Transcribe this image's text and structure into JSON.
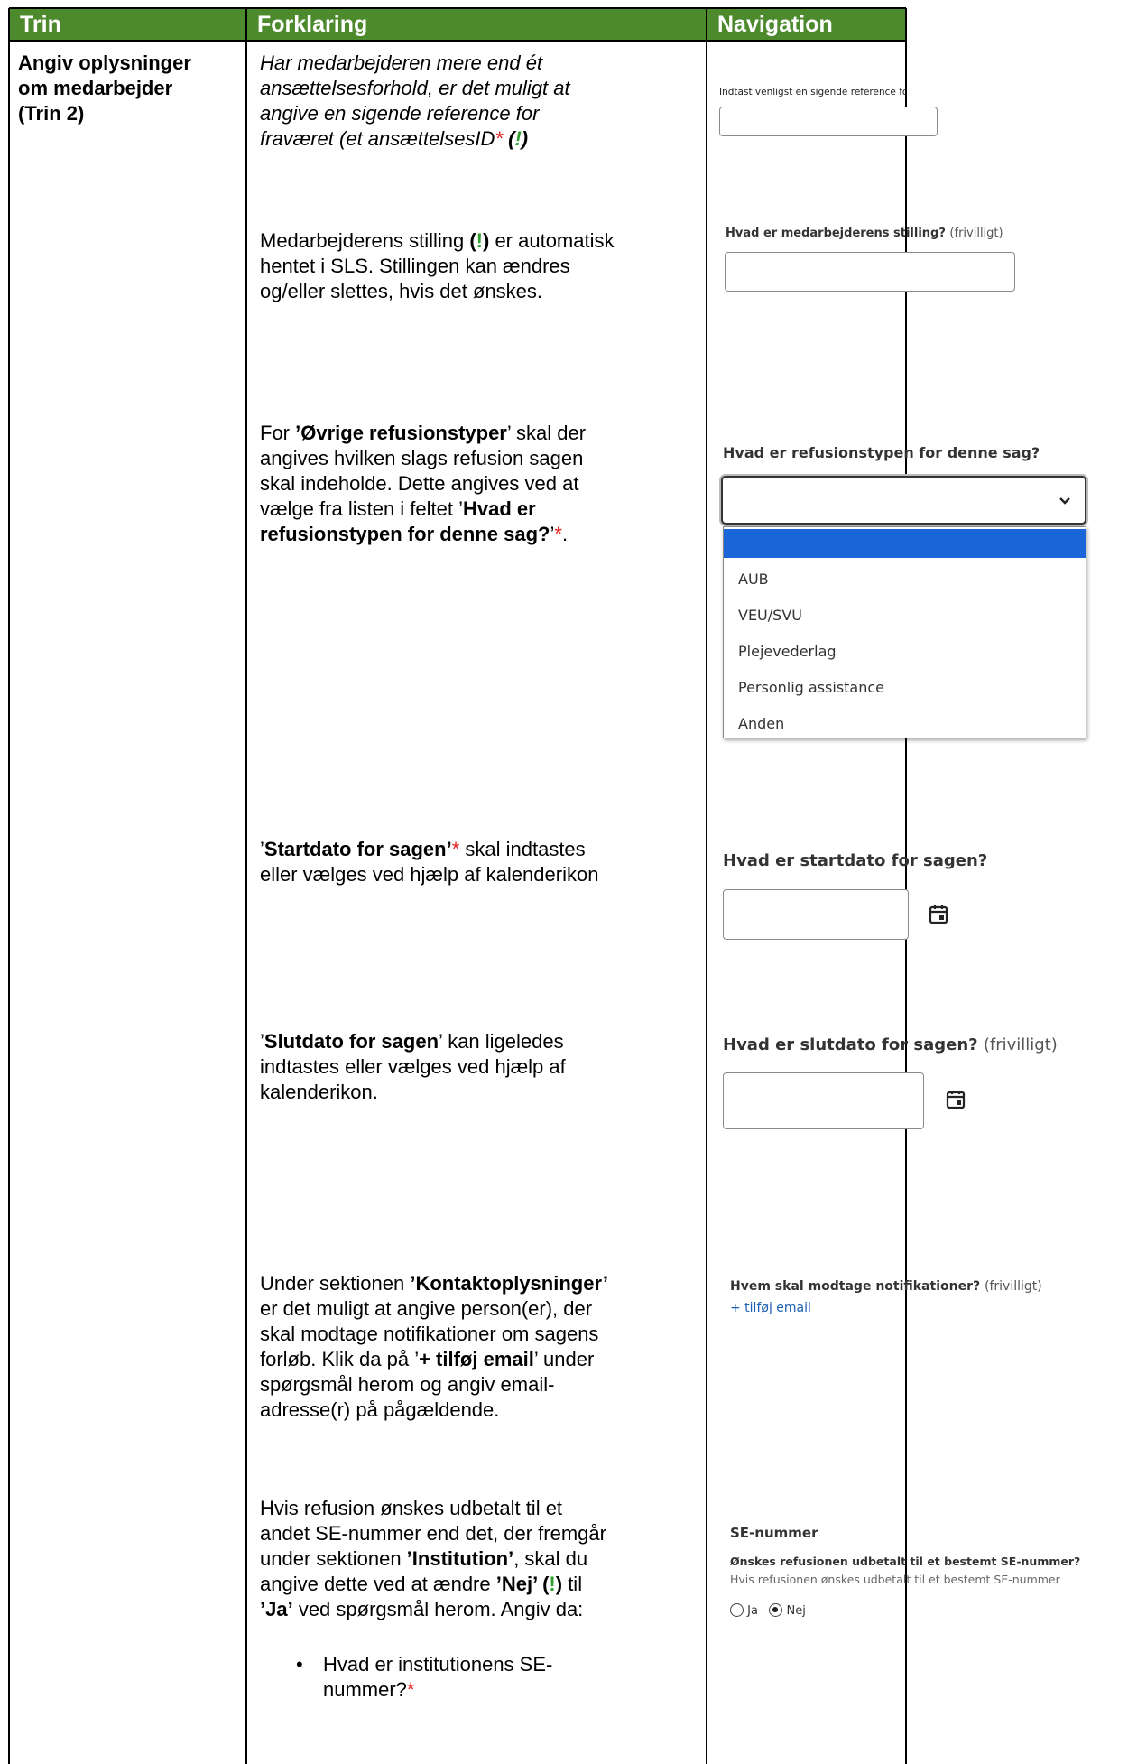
{
  "headers": {
    "col1": "Trin",
    "col2": "Forklaring",
    "col3": "Navigation"
  },
  "step": {
    "l1": "Angiv oplysninger",
    "l2": "om medarbejder",
    "l3": "(Trin 2)"
  },
  "expl": {
    "p1": {
      "l1": "Har medarbejderen mere end ét",
      "l2": "ansættelsesforhold, er det muligt at",
      "l3": "angive en sigende reference for",
      "l4a": "fraværet (et ansættelsesID",
      "star": "*",
      "l4b_open": " (",
      "l4b_bang": "!",
      "l4b_close": ")"
    },
    "p2": {
      "l1a": "Medarbejderens stilling ",
      "l1b_open": "(",
      "l1b_bang": "!",
      "l1b_close": ")",
      "l1c": " er automatisk",
      "l2": "hentet i SLS. Stillingen kan ændres",
      "l3": "og/eller slettes, hvis det ønskes."
    },
    "p3": {
      "l1a": "For ",
      "l1b": "’Øvrige refusionstyper",
      "l1c": "’ skal der",
      "l2": "angives hvilken slags refusion sagen",
      "l3": "skal indeholde. Dette angives ved at",
      "l4a": "vælge fra listen i feltet ’",
      "l4b": "Hvad er",
      "l5a": "refusionstypen for denne sag?",
      "l5b": "’",
      "star": "*",
      "l5c": "."
    },
    "p4": {
      "l1a": "’",
      "l1b": "Startdato for sagen’",
      "star": "*",
      "l1c": " skal indtastes",
      "l2": "eller vælges ved hjælp af kalenderikon"
    },
    "p5": {
      "l1a": "’",
      "l1b": "Slutdato for sagen",
      "l1c": "’ kan ligeledes",
      "l2": "indtastes eller vælges ved hjælp af",
      "l3": "kalenderikon."
    },
    "p6": {
      "l1a": "Under sektionen ",
      "l1b": "’Kontaktoplysninger’",
      "l2": "er det muligt at angive person(er), der",
      "l3": "skal modtage notifikationer om sagens",
      "l4a": "forløb. Klik da på ’",
      "l4b": "+ tilføj email",
      "l4c": "’ under",
      "l5": "spørgsmål herom og angiv email-",
      "l6": "adresse(r) på pågældende."
    },
    "p7": {
      "l1": "Hvis refusion ønskes udbetalt til et",
      "l2": "andet SE-nummer end det, der fremgår",
      "l3a": "under sektionen ",
      "l3b": "’Institution’",
      "l3c": ", skal du",
      "l4a": "angive dette ved at ændre ",
      "l4b": "’Nej’ (",
      "l4bang": "!",
      "l4c": ")",
      "l4d": " til",
      "l5a": "’Ja’",
      "l5b": " ved spørgsmål herom. Angiv da:",
      "bullet": "•",
      "b1": "Hvad er institutionens SE-",
      "b2": "nummer?",
      "star": "*"
    }
  },
  "nav": {
    "ref_label": "Indtast venligst en sigende reference for dette fravær (et ansættelsesID)",
    "stilling_label": "Hvad er medarbejderens stilling?",
    "stilling_opt": "(frivilligt)",
    "refusion_label": "Hvad er refusionstypen for denne sag?",
    "refusion_options": [
      "",
      "AUB",
      "VEU/SVU",
      "Plejevederlag",
      "Personlig assistance",
      "Anden"
    ],
    "start_label": "Hvad er startdato for sagen?",
    "slut_label": "Hvad er slutdato for sagen?",
    "slut_opt": "(frivilligt)",
    "notif_label": "Hvem skal modtage notifikationer?",
    "notif_opt": "(frivilligt)",
    "add_email": "+ tilføj email",
    "se_title": "SE-nummer",
    "se_question": "Ønskes refusionen udbetalt til et bestemt SE-nummer?",
    "se_hint": "Hvis refusionen ønskes udbetalt til et bestemt SE-nummer",
    "radio_yes": "Ja",
    "radio_no": "Nej",
    "radio_selected": "Nej"
  },
  "colors": {
    "header_bg": "#4d8a2e",
    "required": "#e31a1a",
    "info": "#2f9e2f",
    "selected_option": "#1a66d9",
    "link": "#1a5fb4"
  }
}
